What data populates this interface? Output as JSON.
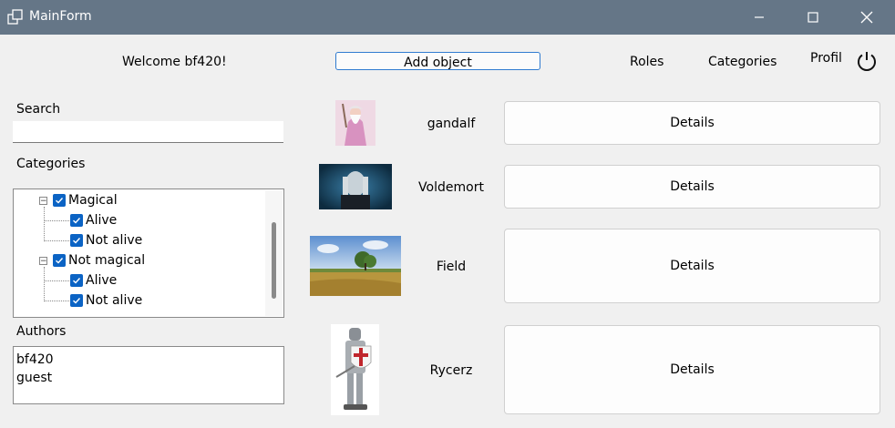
{
  "window": {
    "title": "MainForm"
  },
  "header": {
    "welcome": "Welcome bf420!",
    "add_object": "Add object",
    "roles": "Roles",
    "categories": "Categories",
    "profil": "Profil"
  },
  "search": {
    "label": "Search",
    "value": ""
  },
  "categories": {
    "label": "Categories",
    "tree": [
      {
        "label": "Magical",
        "checked": true,
        "children": [
          {
            "label": "Alive",
            "checked": true
          },
          {
            "label": "Not alive",
            "checked": true
          }
        ]
      },
      {
        "label": "Not magical",
        "checked": true,
        "children": [
          {
            "label": "Alive",
            "checked": true
          },
          {
            "label": "Not alive",
            "checked": true
          }
        ]
      }
    ]
  },
  "authors": {
    "label": "Authors",
    "items": [
      "bf420",
      "guest"
    ]
  },
  "objects": [
    {
      "name": "gandalf",
      "details_label": "Details"
    },
    {
      "name": "Voldemort",
      "details_label": "Details"
    },
    {
      "name": "Field",
      "details_label": "Details"
    },
    {
      "name": "Rycerz",
      "details_label": "Details"
    }
  ],
  "colors": {
    "titlebar": "#657687",
    "checkbox": "#0b63c4",
    "accent_border": "#2f7bd0"
  }
}
